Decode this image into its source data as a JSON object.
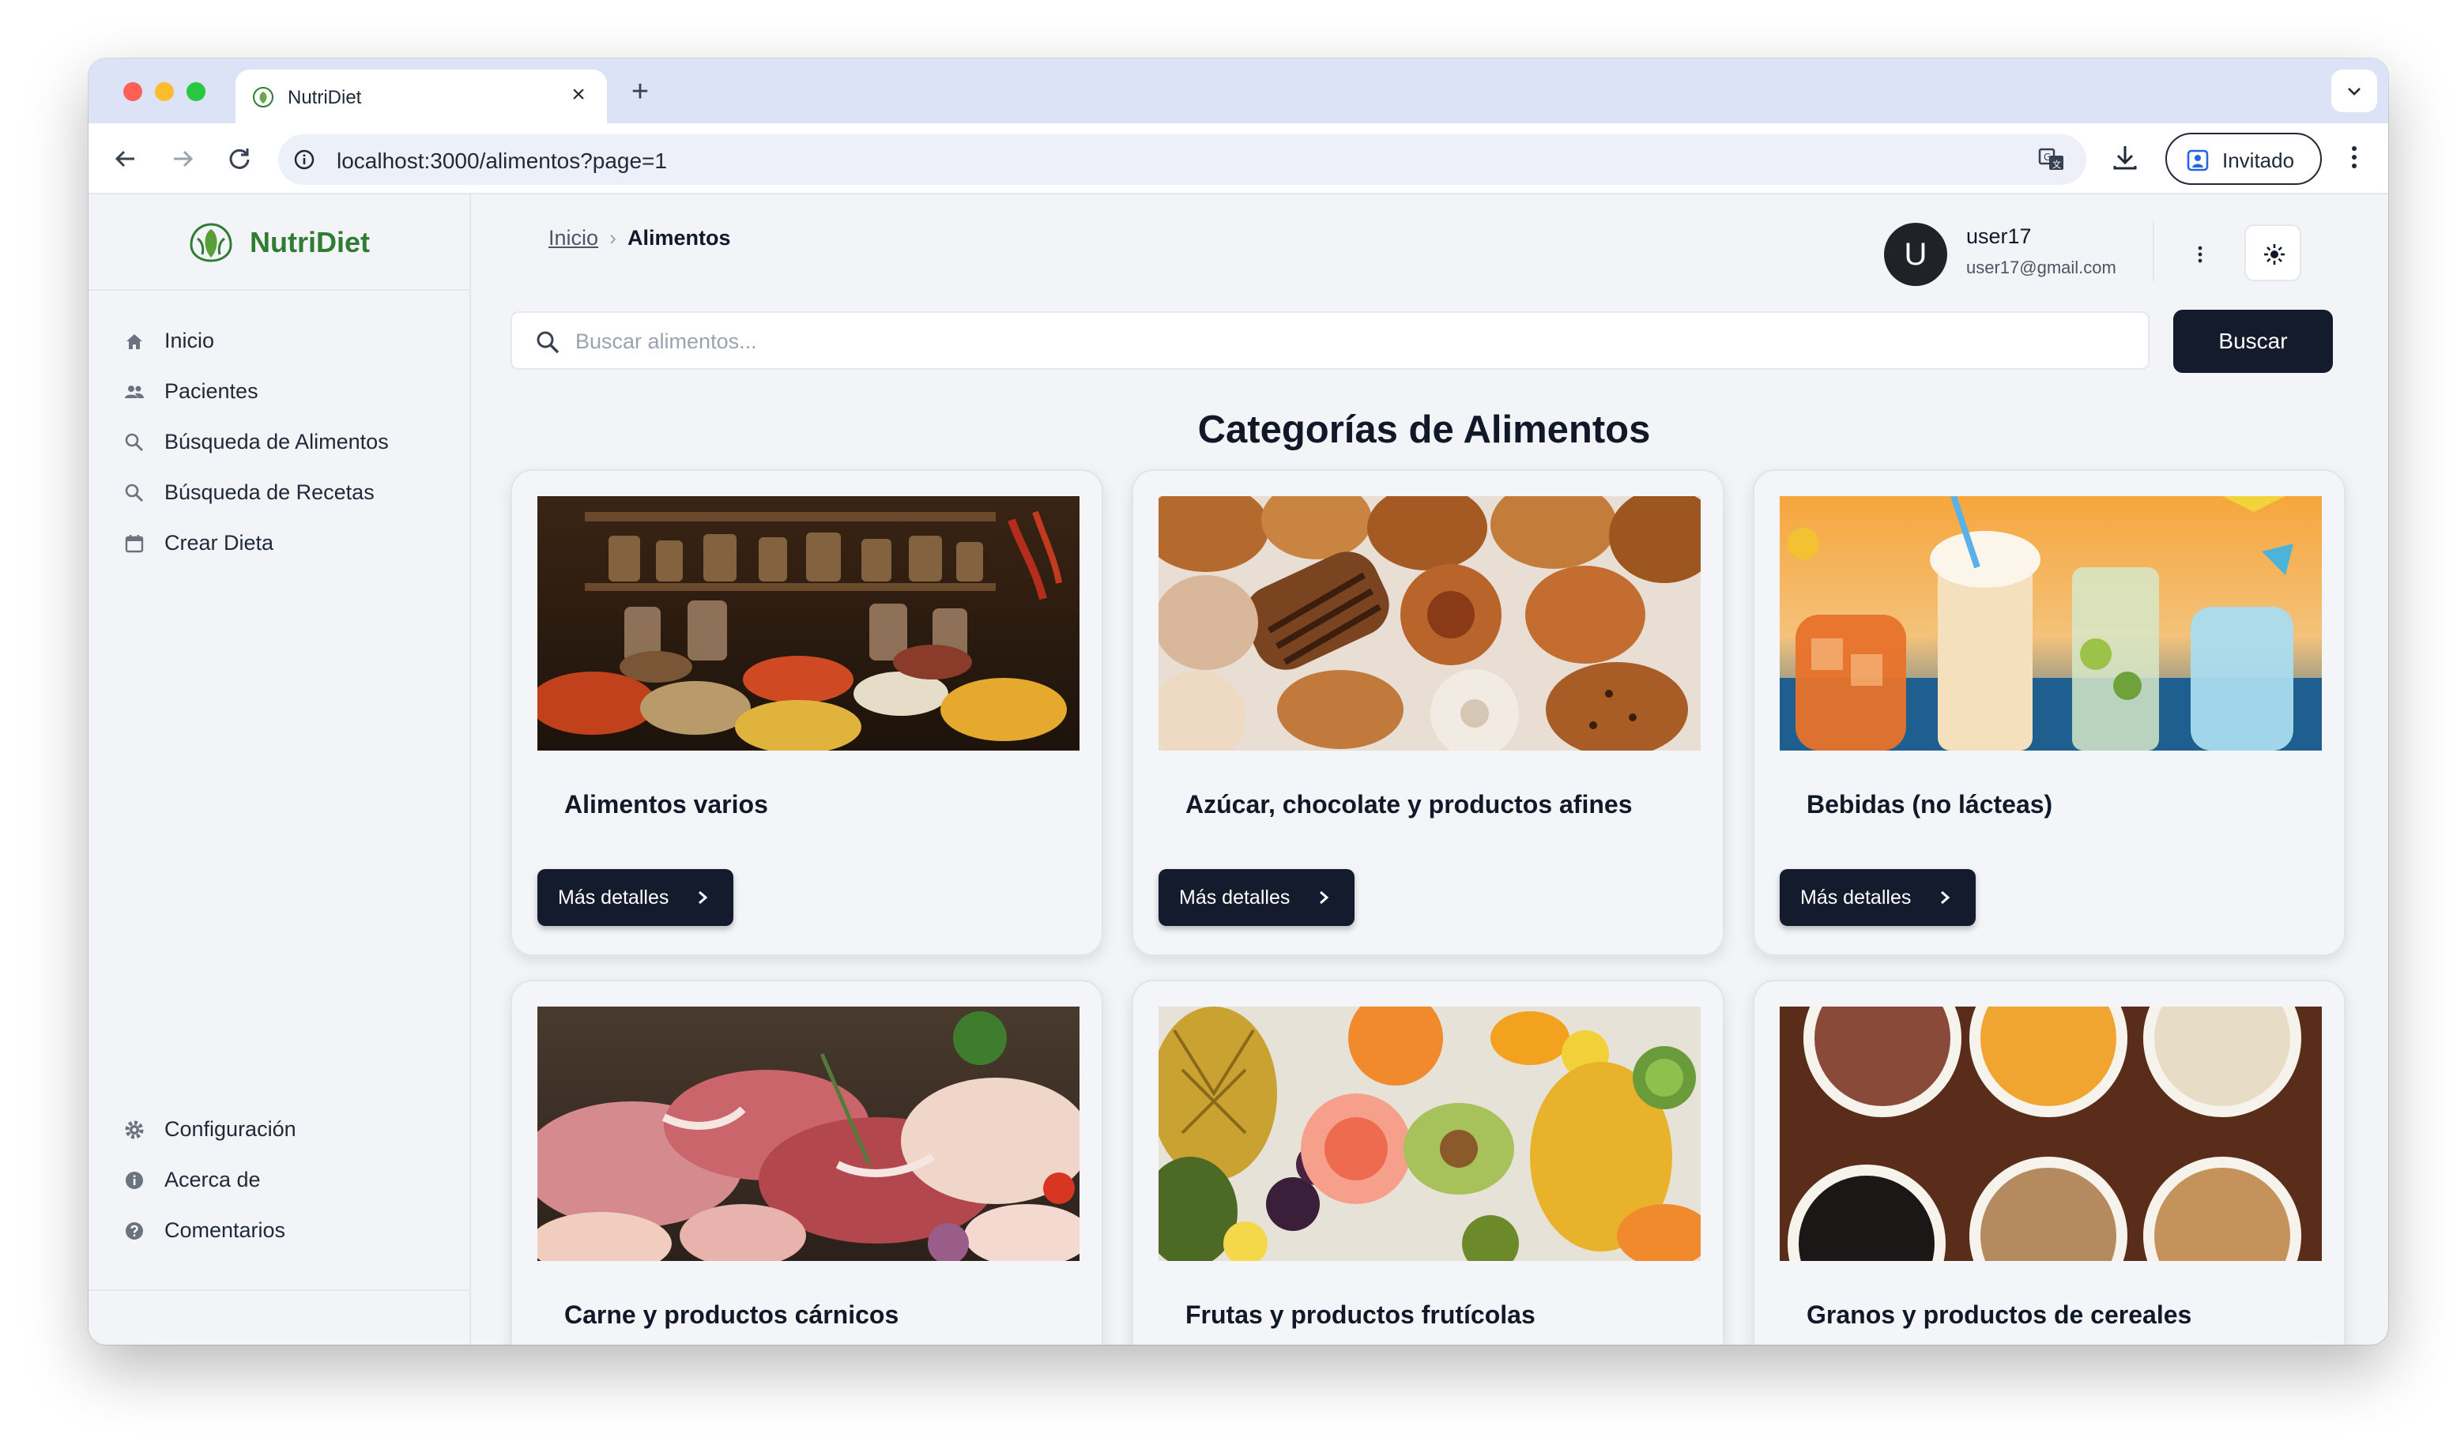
{
  "browser": {
    "tab_title": "NutriDiet",
    "url": "localhost:3000/alimentos?page=1",
    "profile_label": "Invitado",
    "icons": [
      "back-icon",
      "forward-icon",
      "reload-icon",
      "info-icon",
      "translate-icon",
      "download-icon",
      "profile-icon",
      "more-vert-icon",
      "chevron-down-icon",
      "close-icon",
      "plus-icon"
    ]
  },
  "sidebar": {
    "brand": "NutriDiet",
    "nav": [
      {
        "label": "Inicio",
        "icon": "home-icon"
      },
      {
        "label": "Pacientes",
        "icon": "people-icon"
      },
      {
        "label": "Búsqueda de Alimentos",
        "icon": "search-icon"
      },
      {
        "label": "Búsqueda de Recetas",
        "icon": "search-icon"
      },
      {
        "label": "Crear Dieta",
        "icon": "calendar-icon"
      }
    ],
    "bottom": [
      {
        "label": "Configuración",
        "icon": "gear-icon"
      },
      {
        "label": "Acerca de",
        "icon": "info-icon"
      },
      {
        "label": "Comentarios",
        "icon": "help-icon"
      }
    ]
  },
  "header": {
    "breadcrumb_home": "Inicio",
    "breadcrumb_current": "Alimentos",
    "avatar_letter": "U",
    "user_name": "user17",
    "user_email": "user17@gmail.com"
  },
  "search": {
    "placeholder": "Buscar alimentos...",
    "value": "",
    "button": "Buscar"
  },
  "main": {
    "title": "Categorías de Alimentos",
    "details_label": "Más detalles",
    "categories": [
      {
        "name": "Alimentos varios",
        "image": "spices-photo"
      },
      {
        "name": "Azúcar, chocolate y productos afines",
        "image": "pastries-photo"
      },
      {
        "name": "Bebidas (no lácteas)",
        "image": "drinks-photo"
      },
      {
        "name": "Carne y productos cárnicos",
        "image": "meat-photo"
      },
      {
        "name": "Frutas y productos frutícolas",
        "image": "fruits-photo"
      },
      {
        "name": "Granos y productos de cereales",
        "image": "grains-photo"
      }
    ]
  },
  "colors": {
    "brand_green": "#2e7d32",
    "button_dark": "#141b2d",
    "tab_strip": "#dde3f7"
  }
}
